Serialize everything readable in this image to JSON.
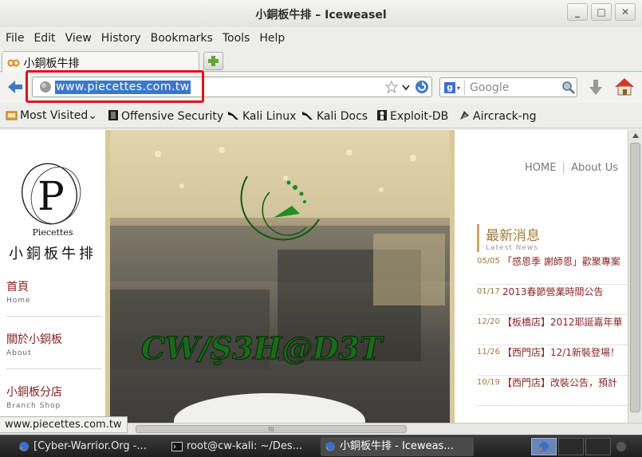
{
  "window": {
    "title": "小銅板牛排 – Iceweasel",
    "controls": {
      "minimize": "_",
      "maximize": "□",
      "close": "✕"
    }
  },
  "menubar": [
    "File",
    "Edit",
    "View",
    "History",
    "Bookmarks",
    "Tools",
    "Help"
  ],
  "tabs": [
    {
      "label": "小銅板牛排"
    }
  ],
  "newtab_icon": "plus-icon",
  "navbar": {
    "url": "www.piecettes.com.tw",
    "search_placeholder": "Google"
  },
  "bookmarks": [
    {
      "label": "Most Visited",
      "icon": "folder-icon",
      "dropdown": "⌄"
    },
    {
      "label": "Offensive Security",
      "icon": "offsec-icon"
    },
    {
      "label": "Kali Linux",
      "icon": "kali-dragon-icon"
    },
    {
      "label": "Kali Docs",
      "icon": "kali-dragon-icon"
    },
    {
      "label": "Exploit-DB",
      "icon": "exploitdb-icon"
    },
    {
      "label": "Aircrack-ng",
      "icon": "aircrack-icon"
    }
  ],
  "page": {
    "logo_letter": "P",
    "logo_text": "Piecettes",
    "brand_name": "小銅板牛排",
    "nav": [
      {
        "zh": "首頁",
        "en": "Home"
      },
      {
        "zh": "關於小銅板",
        "en": "About"
      },
      {
        "zh": "小銅板分店",
        "en": "Branch Shop"
      }
    ],
    "topnav": [
      "HOME",
      "About Us"
    ],
    "topnav_sep": "|",
    "defacement_text": "CW/Ş3H@D3T",
    "news_title": "最新消息",
    "news_subtitle": "Latest News",
    "news": [
      {
        "date": "05/05",
        "title": "「感恩季 謝師恩」歡聚專案"
      },
      {
        "date": "01/17",
        "title": "2013春節營業時間公告"
      },
      {
        "date": "12/20",
        "title": "【板橋店】2012耶誕嘉年華"
      },
      {
        "date": "11/26",
        "title": "【西門店】12/1新裝登場！"
      },
      {
        "date": "10/19",
        "title": "【西門店】改裝公告，預計"
      }
    ]
  },
  "statusbar": "www.piecettes.com.tw",
  "scroll_grip": "III",
  "taskbar": [
    {
      "label": "[Cyber-Warrior.Org -...",
      "icon": "firefox-icon"
    },
    {
      "label": "root@cw-kali: ~/Des...",
      "icon": "terminal-icon"
    },
    {
      "label": "小銅板牛排 - Iceweas...",
      "icon": "firefox-icon",
      "active": true
    }
  ],
  "colors": {
    "selection": "#3d77c9",
    "highlight_box": "#e2131a",
    "link_red": "#8a2626",
    "gold": "#a07c3c"
  }
}
